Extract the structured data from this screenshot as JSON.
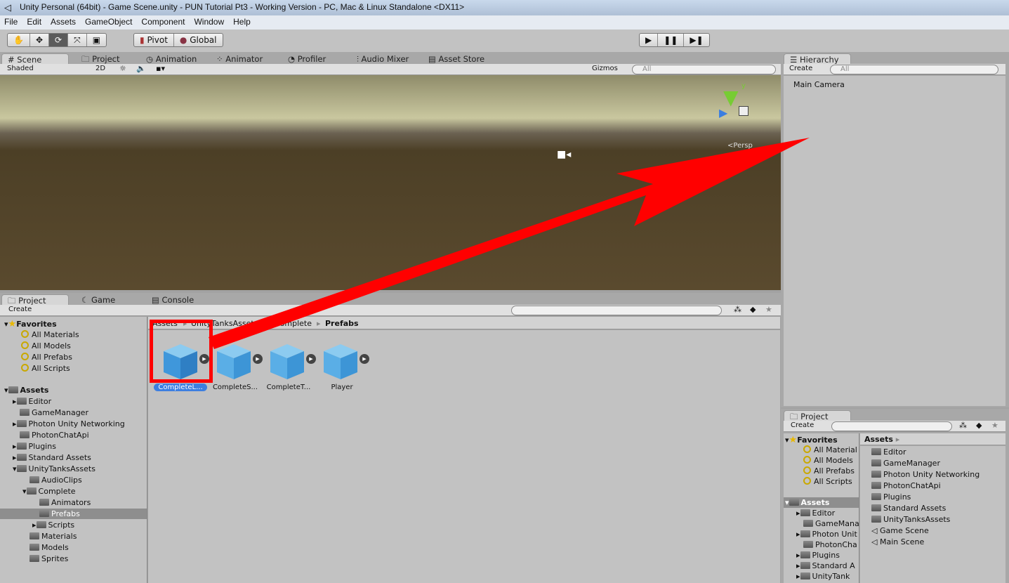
{
  "window": {
    "title": "Unity Personal (64bit) - Game Scene.unity - PUN Tutorial Pt3 - Working Version - PC, Mac & Linux Standalone <DX11>"
  },
  "menu": [
    "File",
    "Edit",
    "Assets",
    "GameObject",
    "Component",
    "Window",
    "Help"
  ],
  "toolbar": {
    "tools": [
      "hand-icon",
      "move-icon",
      "rotate-icon",
      "scale-icon",
      "rect-icon"
    ],
    "active_tool": "rotate-icon",
    "pivot": "Pivot",
    "global": "Global",
    "play": "▶",
    "pause": "❚❚",
    "step": "▶❚"
  },
  "top_tabs": [
    "Scene",
    "Project",
    "Animation",
    "Animator",
    "Profiler",
    "Audio Mixer",
    "Asset Store"
  ],
  "scene": {
    "shading": "Shaded",
    "mode_2d": "2D",
    "gizmos": "Gizmos",
    "search_placeholder": "All",
    "persp": "Persp",
    "axis_y": "y"
  },
  "hierarchy": {
    "tab": "Hierarchy",
    "create": "Create",
    "search_placeholder": "All",
    "items": [
      "Main Camera"
    ]
  },
  "bottom_tabs": [
    "Project",
    "Game",
    "Console"
  ],
  "project": {
    "create": "Create",
    "favorites_label": "Favorites",
    "favorites": [
      "All Materials",
      "All Models",
      "All Prefabs",
      "All Scripts"
    ],
    "assets_label": "Assets",
    "tree": [
      "Editor",
      "GameManager",
      "Photon Unity Networking",
      "PhotonChatApi",
      "Plugins",
      "Standard Assets",
      "UnityTanksAssets",
      "AudioClips",
      "Complete",
      "Animators",
      "Prefabs",
      "Scripts",
      "Materials",
      "Models",
      "Sprites"
    ],
    "breadcrumb": [
      "Assets",
      "UnityTanksAssets",
      "Complete",
      "Prefabs"
    ],
    "prefabs": [
      "CompleteL...",
      "CompleteS...",
      "CompleteT...",
      "Player"
    ]
  },
  "project2": {
    "tab": "Project",
    "create": "Create",
    "favorites_label": "Favorites",
    "favorites": [
      "All Material",
      "All Models",
      "All Prefabs",
      "All Scripts"
    ],
    "assets_label": "Assets",
    "tree": [
      "Editor",
      "GameMana",
      "Photon Unit",
      "PhotonCha",
      "Plugins",
      "Standard A",
      "UnityTank"
    ],
    "breadcrumb": "Assets",
    "folders": [
      "Editor",
      "GameManager",
      "Photon Unity Networking",
      "PhotonChatApi",
      "Plugins",
      "Standard Assets",
      "UnityTanksAssets"
    ],
    "scenes": [
      "Game Scene",
      "Main Scene"
    ]
  },
  "annotation_color": "#ff0000"
}
